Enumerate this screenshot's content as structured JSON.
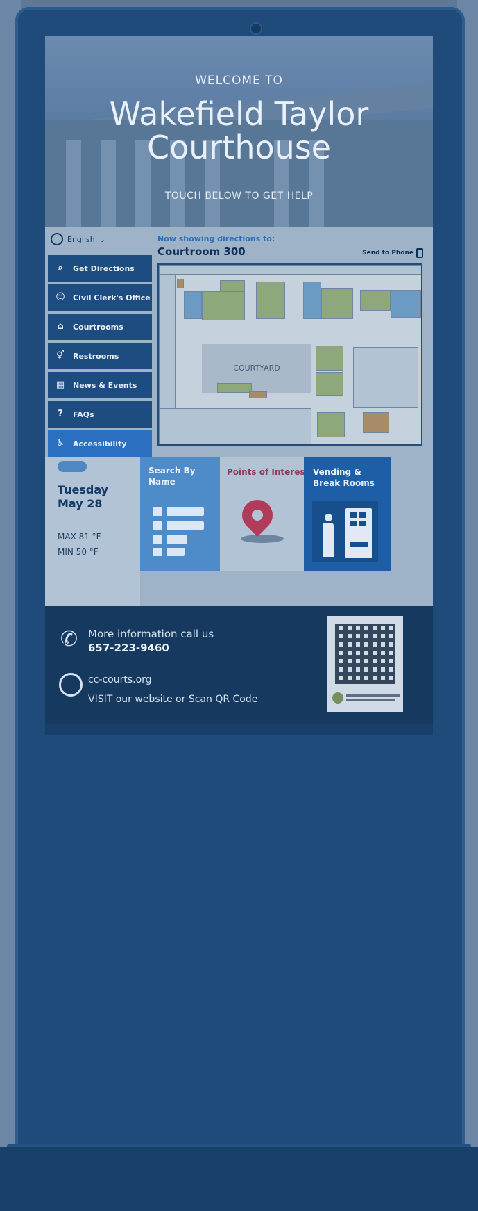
{
  "hero": {
    "welcome": "WELCOME TO",
    "title": "Wakefield Taylor Courthouse",
    "subtitle": "TOUCH BELOW TO GET HELP"
  },
  "language": {
    "selected": "English"
  },
  "menu": {
    "items": [
      {
        "label": "Get Directions",
        "icon": "search-icon"
      },
      {
        "label": "Civil Clerk's Office",
        "icon": "clerk-icon"
      },
      {
        "label": "Courtrooms",
        "icon": "courthouse-icon"
      },
      {
        "label": "Restrooms",
        "icon": "restroom-icon"
      },
      {
        "label": "News & Events",
        "icon": "calendar-icon"
      },
      {
        "label": "FAQs",
        "icon": "question-icon"
      },
      {
        "label": "Accessibility",
        "icon": "accessibility-icon",
        "active": true
      }
    ]
  },
  "directions": {
    "label": "Now showing directions to:",
    "destination": "Courtroom 300",
    "send_to_phone": "Send to Phone"
  },
  "map": {
    "courtyard_label": "COURTYARD"
  },
  "weather": {
    "day": "Tuesday",
    "date": "May 28",
    "max": "MAX 81 °F",
    "min": "MIN 50 °F"
  },
  "tiles": {
    "search": "Search By Name",
    "poi": "Points of Interest",
    "vending": "Vending & Break Rooms"
  },
  "footer": {
    "more_info": "More information call us",
    "phone": "657-223-9460",
    "website": "cc-courts.org",
    "visit_text": "VISIT our website or Scan QR Code"
  }
}
